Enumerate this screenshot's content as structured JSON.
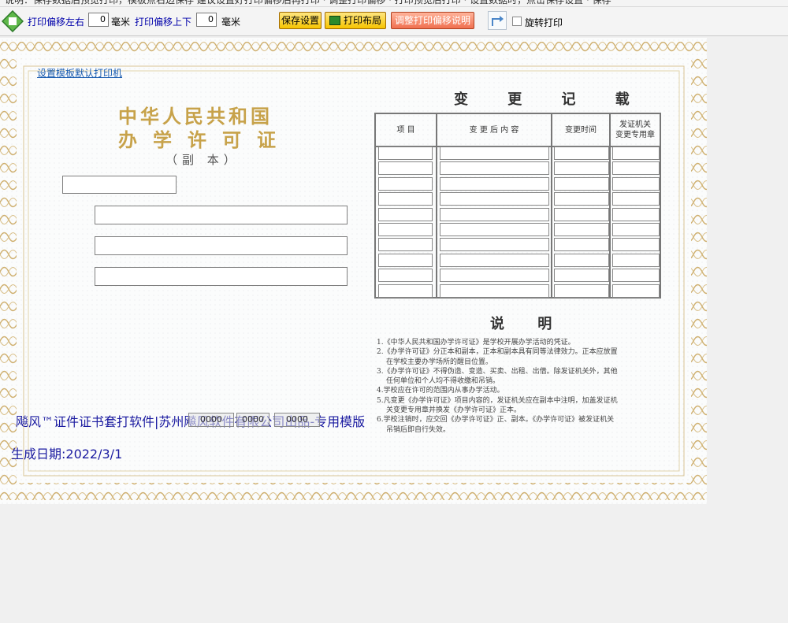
{
  "top_hint": "说明：保存数据后预览打印，模板点右边保存 建议设置好打印偏移后再打印 · 调整打印偏移 · 打印预览后打印 · 设置数据时，点击保存设置 · 保存",
  "toolbar": {
    "offset_lr_label": "打印偏移左右",
    "offset_lr_value": "0",
    "unit_mm_1": "毫米",
    "offset_ud_label": "打印偏移上下",
    "offset_ud_value": "0",
    "unit_mm_2": "毫米",
    "save_button": "保存设置",
    "layout_button": "打印布局",
    "adjust_help_button": "调整打印偏移说明",
    "rotate_label": "旋转打印",
    "rotate_checked": false
  },
  "certificate": {
    "default_printer_link": "设置模板默认打印机",
    "title_line1": "中华人民共和国",
    "title_line2": "办学许可证",
    "subtitle": "（副  本）",
    "record_title": "变 更 记 载",
    "record_headers": [
      "项  目",
      "变 更 后 内 容",
      "变更时间",
      "发证机关\n变更专用章"
    ],
    "record_row_count": 10,
    "notes_title": "说 明",
    "notes": [
      "1.《中华人民共和国办学许可证》是学校开展办学活动的凭证。",
      "2.《办学许可证》分正本和副本，正本和副本具有同等法律效力。正本应放置",
      "在学校主要办学场所的醒目位置。",
      "3.《办学许可证》不得伪造、变造、买卖、出租、出借。除发证机关外，其他",
      "任何单位和个人均不得收缴和吊销。",
      "4.学校应在许可的范围内从事办学活动。",
      "5.凡变更《办学许可证》项目内容的，发证机关应在副本中注明，加盖发证机",
      "关变更专用章并换发《办学许可证》正本。",
      "6.学校注销时，应交回《办学许可证》正、副本。《办学许可证》被发证机关",
      "吊销后即自行失效。"
    ],
    "notes_indent": [
      false,
      false,
      true,
      false,
      true,
      false,
      false,
      true,
      false,
      true
    ],
    "footer_line": "飚风™证件证书套打软件|苏州飚风软件有限公司出品-专用模版",
    "footer_date": "生成日期:2022/3/1",
    "overlay_buttons": [
      "0000",
      "0000",
      "0000"
    ]
  },
  "colors": {
    "toolbar_label": "#0000aa",
    "gold": "#c7a24a",
    "footer_text": "#1a1aa0",
    "link": "#1a5cb0"
  }
}
